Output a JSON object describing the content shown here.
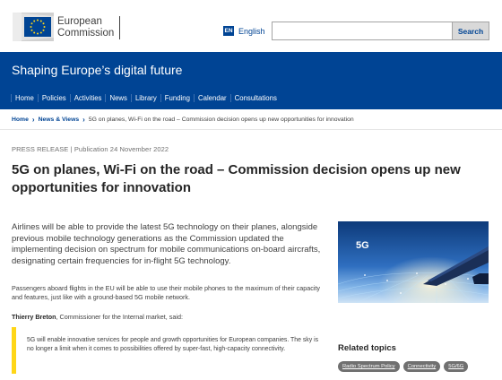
{
  "header": {
    "logo_line1": "European",
    "logo_line2": "Commission",
    "language_code": "EN",
    "language_label": "English",
    "search_placeholder": "",
    "search_button": "Search"
  },
  "banner": {
    "site_title": "Shaping Europe’s digital future",
    "nav": [
      "Home",
      "Policies",
      "Activities",
      "News",
      "Library",
      "Funding",
      "Calendar",
      "Consultations"
    ]
  },
  "breadcrumb": {
    "items": [
      "Home",
      "News & Views",
      "5G on planes, Wi-Fi on the road – Commission decision opens up new opportunities for innovation"
    ]
  },
  "article": {
    "meta": "PRESS RELEASE | Publication 24 November 2022",
    "headline": "5G on planes, Wi-Fi on the road – Commission decision opens up new opportunities for innovation",
    "lead": "Airlines will be able to provide the latest 5G technology on their planes, alongside previous mobile technology generations as the Commission updated the implementing decision on spectrum for mobile communications on-board aircrafts, designating certain frequencies for in-flight 5G technology.",
    "paragraph": "Passengers aboard flights in the EU will be able to use their mobile phones to the maximum of their capacity and features, just like with a ground-based 5G mobile network.",
    "speaker_name": "Thierry Breton",
    "speaker_role": ", Commissioner for the Internal market, said:",
    "quote": "5G will enable innovative services for people and growth opportunities for European companies. The sky is no longer a limit when it comes to possibilities offered by super-fast, high-capacity connectivity."
  },
  "sidebar": {
    "image_label": "5G",
    "related_title": "Related topics",
    "tags": [
      "Radio Spectrum Policy",
      "Connectivity",
      "5G/6G"
    ]
  },
  "colors": {
    "brand_blue": "#004494",
    "accent_yellow": "#ffd617",
    "tag_grey": "#707070"
  }
}
